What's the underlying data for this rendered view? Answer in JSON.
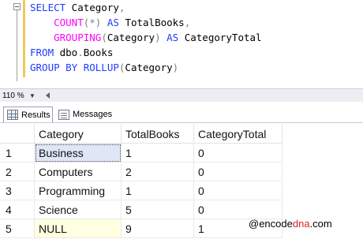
{
  "editor": {
    "lines": [
      [
        {
          "t": "SELECT",
          "c": "kw"
        },
        {
          "t": " Category",
          "c": "plain"
        },
        {
          "t": ",",
          "c": "gray"
        }
      ],
      [
        {
          "t": "    ",
          "c": "plain"
        },
        {
          "t": "COUNT",
          "c": "fn"
        },
        {
          "t": "(*)",
          "c": "gray"
        },
        {
          "t": " ",
          "c": "plain"
        },
        {
          "t": "AS",
          "c": "kw"
        },
        {
          "t": " TotalBooks",
          "c": "plain"
        },
        {
          "t": ",",
          "c": "gray"
        }
      ],
      [
        {
          "t": "    ",
          "c": "plain"
        },
        {
          "t": "GROUPING",
          "c": "fn"
        },
        {
          "t": "(",
          "c": "gray"
        },
        {
          "t": "Category",
          "c": "plain"
        },
        {
          "t": ")",
          "c": "gray"
        },
        {
          "t": " ",
          "c": "plain"
        },
        {
          "t": "AS",
          "c": "kw"
        },
        {
          "t": " CategoryTotal",
          "c": "plain"
        }
      ],
      [
        {
          "t": "FROM",
          "c": "kw"
        },
        {
          "t": " dbo",
          "c": "plain"
        },
        {
          "t": ".",
          "c": "gray"
        },
        {
          "t": "Books",
          "c": "plain"
        }
      ],
      [
        {
          "t": "GROUP BY ROLLUP",
          "c": "kw"
        },
        {
          "t": "(",
          "c": "gray"
        },
        {
          "t": "Category",
          "c": "plain"
        },
        {
          "t": ")",
          "c": "gray"
        }
      ]
    ]
  },
  "zoom": {
    "value": "110 %"
  },
  "tabs": {
    "results": "Results",
    "messages": "Messages"
  },
  "grid": {
    "columns": [
      "Category",
      "TotalBooks",
      "CategoryTotal"
    ],
    "rows": [
      {
        "num": "1",
        "cells": [
          "Business",
          "1",
          "0"
        ]
      },
      {
        "num": "2",
        "cells": [
          "Computers",
          "2",
          "0"
        ]
      },
      {
        "num": "3",
        "cells": [
          "Programming",
          "1",
          "0"
        ]
      },
      {
        "num": "4",
        "cells": [
          "Science",
          "5",
          "0"
        ]
      },
      {
        "num": "5",
        "cells": [
          "NULL",
          "9",
          "1"
        ]
      }
    ]
  },
  "watermark": {
    "prefix": "@encode",
    "accent": "dna",
    "suffix": ".com"
  },
  "colors": {
    "keyword": "#1f3cff",
    "function": "#ff00ff",
    "selection": "#dfe7f7",
    "null_bg": "#ffffe1",
    "change_bar": "#f0c95c"
  }
}
